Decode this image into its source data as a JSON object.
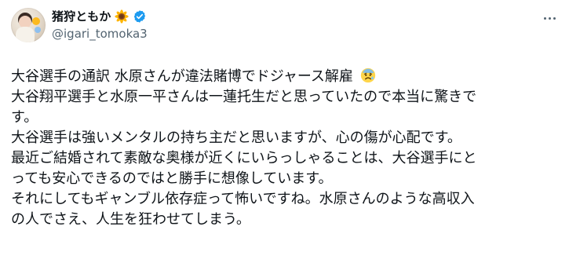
{
  "post": {
    "author": {
      "display_name": "猪狩ともか",
      "name_emoji": "sunflower-icon",
      "verified": true,
      "verified_badge_color": "#1d9bf0",
      "handle": "@igari_tomoka3"
    },
    "menu": {
      "icon": "more-horizontal-icon"
    },
    "text": {
      "lines": [
        "大谷選手の通訳 水原さんが違法賭博でドジャース解雇",
        "大谷翔平選手と水原一平さんは一蓮托生だと思っていたので本当に驚きで",
        "す。",
        "大谷選手は強いメンタルの持ち主だと思いますが、心の傷が心配です。",
        "最近ご結婚されて素敵な奥様が近くにいらっしゃることは、大谷選手にと",
        "っても安心できるのではと勝手に想像しています。",
        "それにしてもギャンブル依存症って怖いですね。水原さんのような高収入",
        "の人でさえ、人生を狂わせてしまう。"
      ],
      "line_1_emoji": "worried-face-icon"
    }
  }
}
